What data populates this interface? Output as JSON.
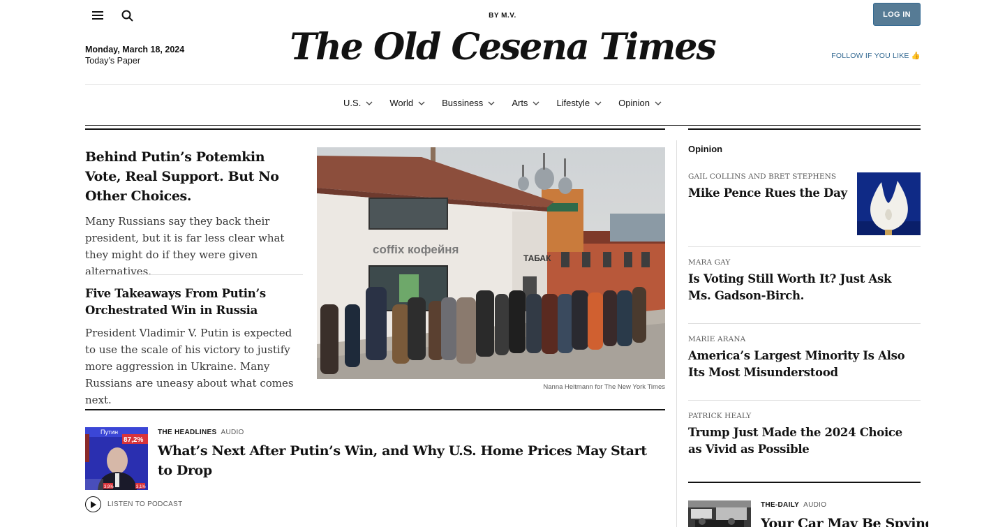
{
  "header": {
    "byline": "BY M.V.",
    "masthead": "The Old Cesena Times",
    "login_label": "LOG IN",
    "date": "Monday, March 18, 2024",
    "todays_paper": "Today’s Paper",
    "follow": "FOLLOW IF YOU LIKE 👍",
    "menu_icon": "hamburger-menu-icon",
    "search_icon": "search-icon"
  },
  "nav": {
    "items": [
      {
        "label": "U.S."
      },
      {
        "label": "World"
      },
      {
        "label": "Bussiness"
      },
      {
        "label": "Arts"
      },
      {
        "label": "Lifestyle"
      },
      {
        "label": "Opinion"
      }
    ]
  },
  "main": {
    "lead": {
      "headline": "Behind Putin’s Potemkin Vote, Real Support. But No Other Choices.",
      "summary": "Many Russians say they back their president, but it is far less clear what they might do if they were given alternatives."
    },
    "second": {
      "headline": "Five Takeaways From Putin’s Orchestrated Win in Russia",
      "summary": "President Vladimir V. Putin is expected to use the scale of his victory to justify more aggression in Ukraine. Many Russians are uneasy about what comes next."
    },
    "photo": {
      "storefront_text": "coffix кофейня",
      "side_text": "ТАБАК",
      "credit": "Nanna Heitmann for The New York Times"
    },
    "podcast": {
      "kicker": "THE HEADLINES",
      "type": "AUDIO",
      "title": "What’s Next After Putin’s Win, and Why U.S. Home Prices May Start to Drop",
      "listen_label": "LISTEN TO PODCAST",
      "thumb_label": "Путин",
      "thumb_percent": "87,2%",
      "thumb_small_1": "3,9%",
      "thumb_small_2": "3,1%"
    }
  },
  "opinion": {
    "section_label": "Opinion",
    "items": [
      {
        "author": "GAIL COLLINS AND BRET STEPHENS",
        "title": "Mike Pence Rues the Day"
      },
      {
        "author": "MARA GAY",
        "title": "Is Voting Still Worth It? Just Ask Ms. Gadson-Birch."
      },
      {
        "author": "MARIE ARANA",
        "title": "America’s Largest Minority Is Also Its Most Misunderstood"
      },
      {
        "author": "PATRICK HEALY",
        "title": "Trump Just Made the 2024 Choice as Vivid as Possible"
      }
    ],
    "daily": {
      "kicker": "THE-DAILY",
      "type": "AUDIO",
      "title": "Your Car May Be Spying"
    }
  },
  "colors": {
    "accent": "#326891",
    "login_bg": "#567b95",
    "text": "#121212",
    "muted": "#5a5a5a"
  }
}
